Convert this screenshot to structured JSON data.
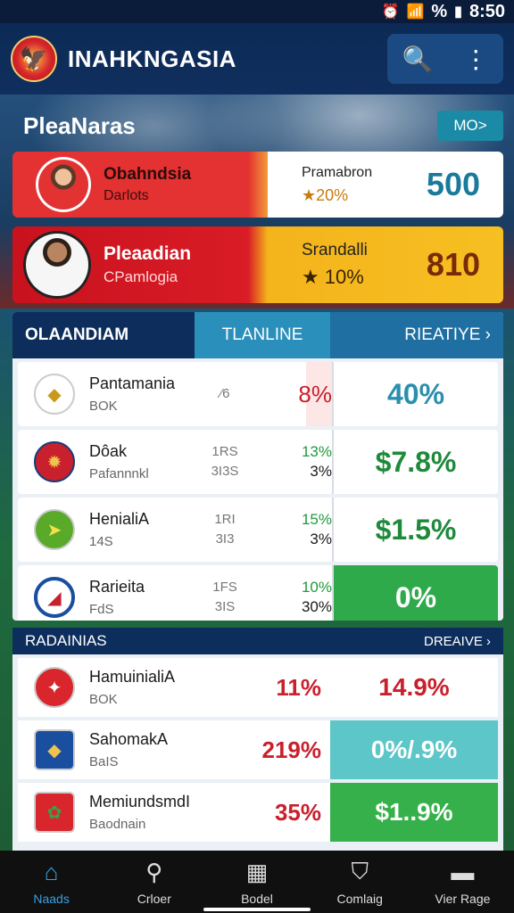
{
  "status": {
    "time": "8:50",
    "icons": [
      "alarm-icon",
      "wifi-icon",
      "signal-icon",
      "battery-icon"
    ],
    "battery": "%"
  },
  "header": {
    "title": "INAHKNGASIA"
  },
  "section": {
    "title": "PleaNaras",
    "badge": "MO>"
  },
  "featured": [
    {
      "name": "Obahndsia",
      "sub": "Darlots",
      "mid_label": "Pramabron",
      "mid_value": "★20%",
      "value": "500"
    },
    {
      "name": "Pleaadian",
      "sub": "CPamlogia",
      "mid_label": "Srandalli",
      "mid_value": "★ 10%",
      "value": "810"
    }
  ],
  "tabs": {
    "t1": "OLAANDIAM",
    "t2": "TLANLINE",
    "t3": "RIEATIYE ›"
  },
  "rows": [
    {
      "name": "Pantamania",
      "sub": "BOK",
      "mid1": "⁄6",
      "mid2": "",
      "pct1": "8%",
      "pct2": "",
      "value": "40%"
    },
    {
      "name": "Dôak",
      "sub": "Pafannnkl",
      "mid1": "1RS",
      "mid2": "3I3S",
      "pct1": "13%",
      "pct2": "3%",
      "value": "$7.8%"
    },
    {
      "name": "HenialiA",
      "sub": "14S",
      "mid1": "1RI",
      "mid2": "3I3",
      "pct1": "15%",
      "pct2": "3%",
      "value": "$1.5%"
    },
    {
      "name": "Rarieita",
      "sub": "FdS",
      "mid1": "1FS",
      "mid2": "3IS",
      "pct1": "10%",
      "pct2": "30%",
      "value": "0%"
    }
  ],
  "table2": {
    "left": "RADAINIAS",
    "right": "DREAIVE ›"
  },
  "rows2": [
    {
      "name": "HamuinialiA",
      "sub": "BOK",
      "pct": "11%",
      "value": "14.9%"
    },
    {
      "name": "SahomakA",
      "sub": "BaIS",
      "pct": "219%",
      "value": "0%/.9%"
    },
    {
      "name": "MemiundsmdI",
      "sub": "Baodnain",
      "pct": "35%",
      "value": "$1..9%"
    }
  ],
  "nav": [
    "Naads",
    "Crloer",
    "Bodel",
    "Comlaig",
    "Vier Rage"
  ]
}
